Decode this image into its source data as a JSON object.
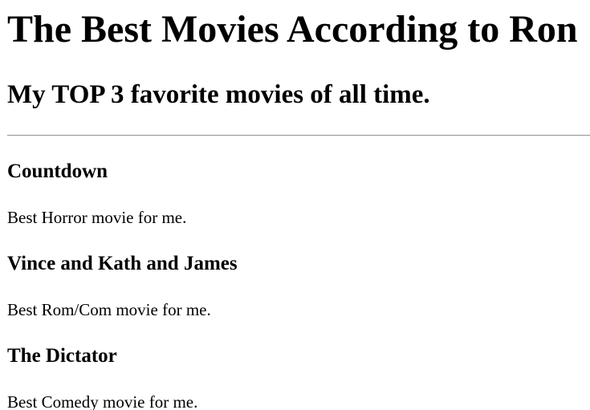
{
  "header": {
    "title": "The Best Movies According to Ron",
    "subtitle": "My TOP 3 favorite movies of all time."
  },
  "movies": [
    {
      "title": "Countdown",
      "description": "Best Horror movie for me."
    },
    {
      "title": "Vince and Kath and James",
      "description": "Best Rom/Com movie for me."
    },
    {
      "title": "The Dictator",
      "description": "Best Comedy movie for me."
    }
  ]
}
